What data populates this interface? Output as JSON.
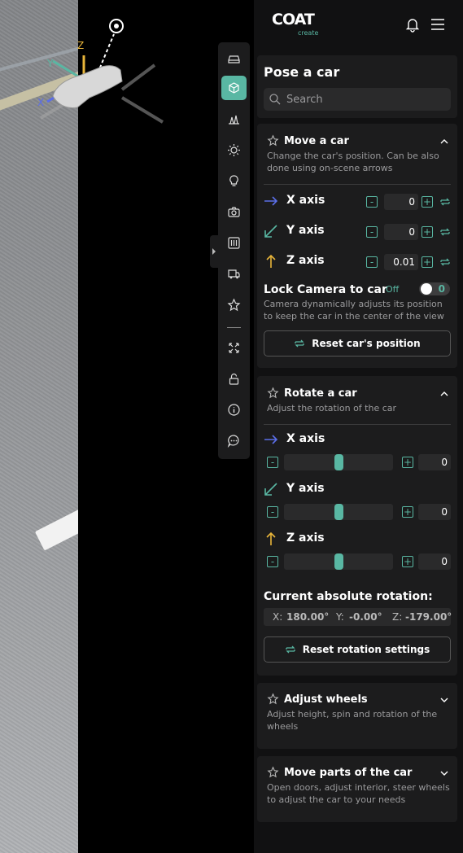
{
  "scene": {
    "gizmo_axes": {
      "x": "X",
      "y": "Y",
      "z": "Z"
    }
  },
  "toolbar": {
    "items": [
      "car-icon",
      "pose-icon",
      "scene-icon",
      "sun-icon",
      "bulb-icon",
      "camera-icon",
      "settings-icon",
      "transport-icon",
      "star-icon",
      "fullscreen-icon",
      "lock-icon",
      "info-icon",
      "chat-icon"
    ],
    "active": "pose-icon",
    "accent": "#59b7a3"
  },
  "header": {
    "logo": "COAT",
    "logo_sub": "create"
  },
  "pose": {
    "title": "Pose a car",
    "search_placeholder": "Search"
  },
  "move": {
    "title": "Move a car",
    "description": "Change the car's position. Can be also done using on-scene arrows",
    "axes": [
      {
        "label": "X axis",
        "value": "0"
      },
      {
        "label": "Y axis",
        "value": "0"
      },
      {
        "label": "Z axis",
        "value": "0.01"
      }
    ],
    "lock_label": "Lock Camera to car",
    "lock_state": "Off",
    "lock_value": "0",
    "lock_description": "Camera dynamically adjusts its position to keep the car in the center of the view",
    "reset_label": "Reset car's position"
  },
  "rotate": {
    "title": "Rotate a car",
    "description": "Adjust the rotation of the car",
    "axes": [
      {
        "label": "X axis",
        "value": "0",
        "slider_fraction": 0.5
      },
      {
        "label": "Y axis",
        "value": "0",
        "slider_fraction": 0.5
      },
      {
        "label": "Z axis",
        "value": "0",
        "slider_fraction": 0.5
      }
    ],
    "absolute_label": "Current absolute rotation:",
    "abs": {
      "x_label": "X:",
      "x": "180.00°",
      "y_label": "Y:",
      "y": "-0.00°",
      "z_label": "Z:",
      "z": "-179.00°"
    },
    "reset_label": "Reset rotation settings"
  },
  "wheels": {
    "title": "Adjust wheels",
    "description": "Adjust height, spin and rotation of the wheels"
  },
  "parts": {
    "title": "Move parts of the car",
    "description": "Open doors, adjust interior, steer wheels to adjust the car to your needs"
  },
  "colors": {
    "x_axis": "#5b6ee8",
    "y_axis": "#59b7a3",
    "z_axis": "#e8b53a",
    "accent": "#59b7a3"
  }
}
